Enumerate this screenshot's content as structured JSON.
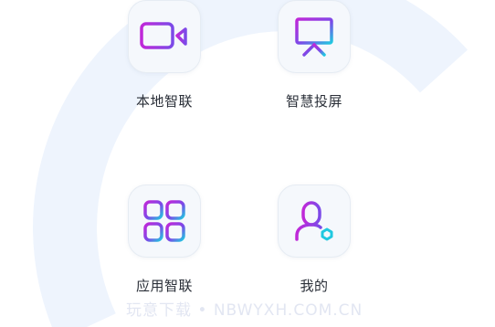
{
  "tiles": [
    {
      "label": "本地智联",
      "icon": "video-camera-icon"
    },
    {
      "label": "智慧投屏",
      "icon": "projection-screen-icon"
    },
    {
      "label": "应用智联",
      "icon": "app-grid-icon"
    },
    {
      "label": "我的",
      "icon": "user-settings-icon"
    }
  ],
  "watermark": "玩意下载 • NBWYXH.COM.CN",
  "colors": {
    "gradient_start": "#c028d8",
    "gradient_mid": "#7b4ae8",
    "gradient_end": "#20c8e0",
    "arc": "#eef4fd"
  }
}
